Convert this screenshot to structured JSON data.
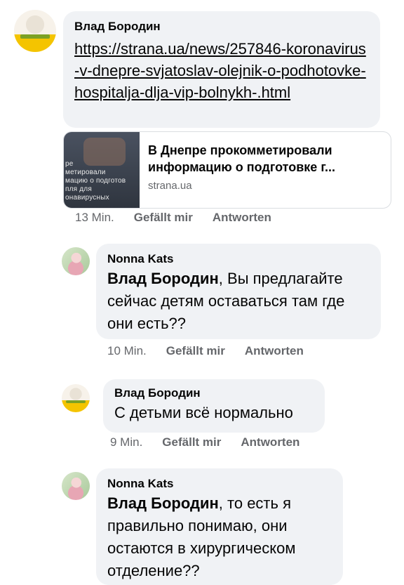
{
  "comments": [
    {
      "author": "Влад Бородин",
      "link": "https://strana.ua/news/257846-koronavirus-v-dnepre-svjatoslav-olejnik-o-podhotovke-hospitalja-dlja-vip-bolnykh-.html",
      "card": {
        "thumb_text": "ре\nметировали\nмацию о подготов\nпля для\nонавирусных",
        "title_line1": "В Днепре прокомметировали",
        "title_line2": "информацию о подготовке г...",
        "domain": "strana.ua"
      },
      "time": "13 Min.",
      "like": "Gefällt mir",
      "reply": "Antworten"
    },
    {
      "author": "Nonna Kats",
      "mention": "Влад Бородин",
      "text": ", Вы предлагайте сейчас детям оставаться там где они есть??",
      "time": "10 Min.",
      "like": "Gefällt mir",
      "reply": "Antworten"
    },
    {
      "author": "Влад Бородин",
      "text": "С детьми всё нормально",
      "time": "9 Min.",
      "like": "Gefällt mir",
      "reply": "Antworten"
    },
    {
      "author": "Nonna Kats",
      "mention": "Влад Бородин",
      "text": ", то есть я правильно понимаю, они остаются в хирургическом отделение??"
    }
  ]
}
